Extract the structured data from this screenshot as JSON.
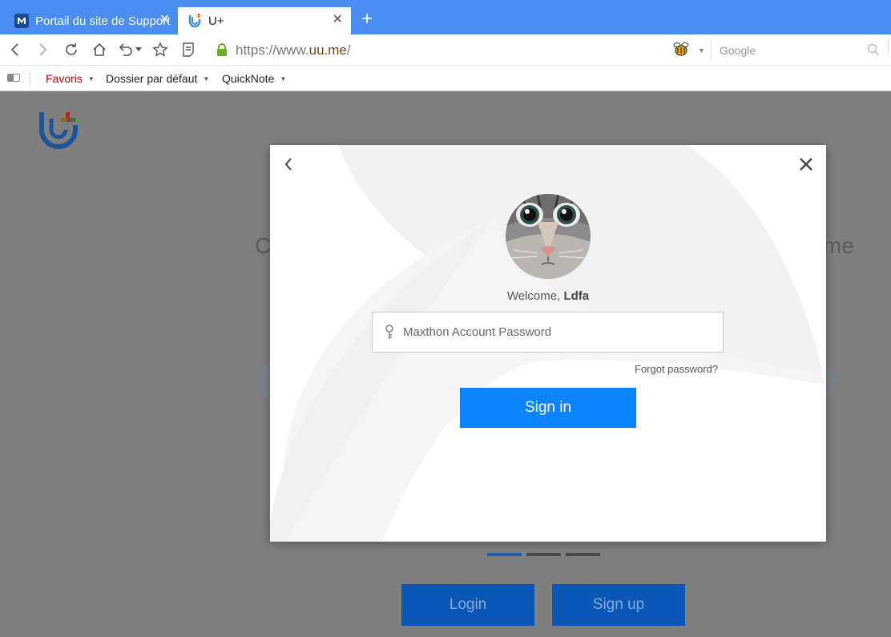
{
  "tabs": [
    {
      "title": "Portail du site de Support",
      "close": "✕",
      "active": false
    },
    {
      "title": "U+",
      "close": "✕",
      "active": true
    }
  ],
  "new_tab": "+",
  "nav": {
    "url_protocol": "https://www.",
    "url_domain": "uu.me",
    "url_path": "/",
    "search_placeholder": "Google"
  },
  "bookmarks": [
    {
      "label": "Favoris"
    },
    {
      "label": "Dossier par défaut"
    },
    {
      "label": "QuickNote"
    }
  ],
  "background_page": {
    "text_left": "C",
    "text_right": "me",
    "login_label": "Login",
    "signup_label": "Sign up",
    "carousel_active_index": 0,
    "carousel_count": 3
  },
  "modal": {
    "welcome_prefix": "Welcome, ",
    "username": "Ldfa",
    "password_placeholder": "Maxthon Account Password",
    "password_value": "",
    "forgot_label": "Forgot password?",
    "signin_label": "Sign in"
  },
  "colors": {
    "tabbar": "#4a8df0",
    "signin": "#0a84ff",
    "page_buttons": "#0b57b7",
    "overlay": "#7f7f7f"
  }
}
